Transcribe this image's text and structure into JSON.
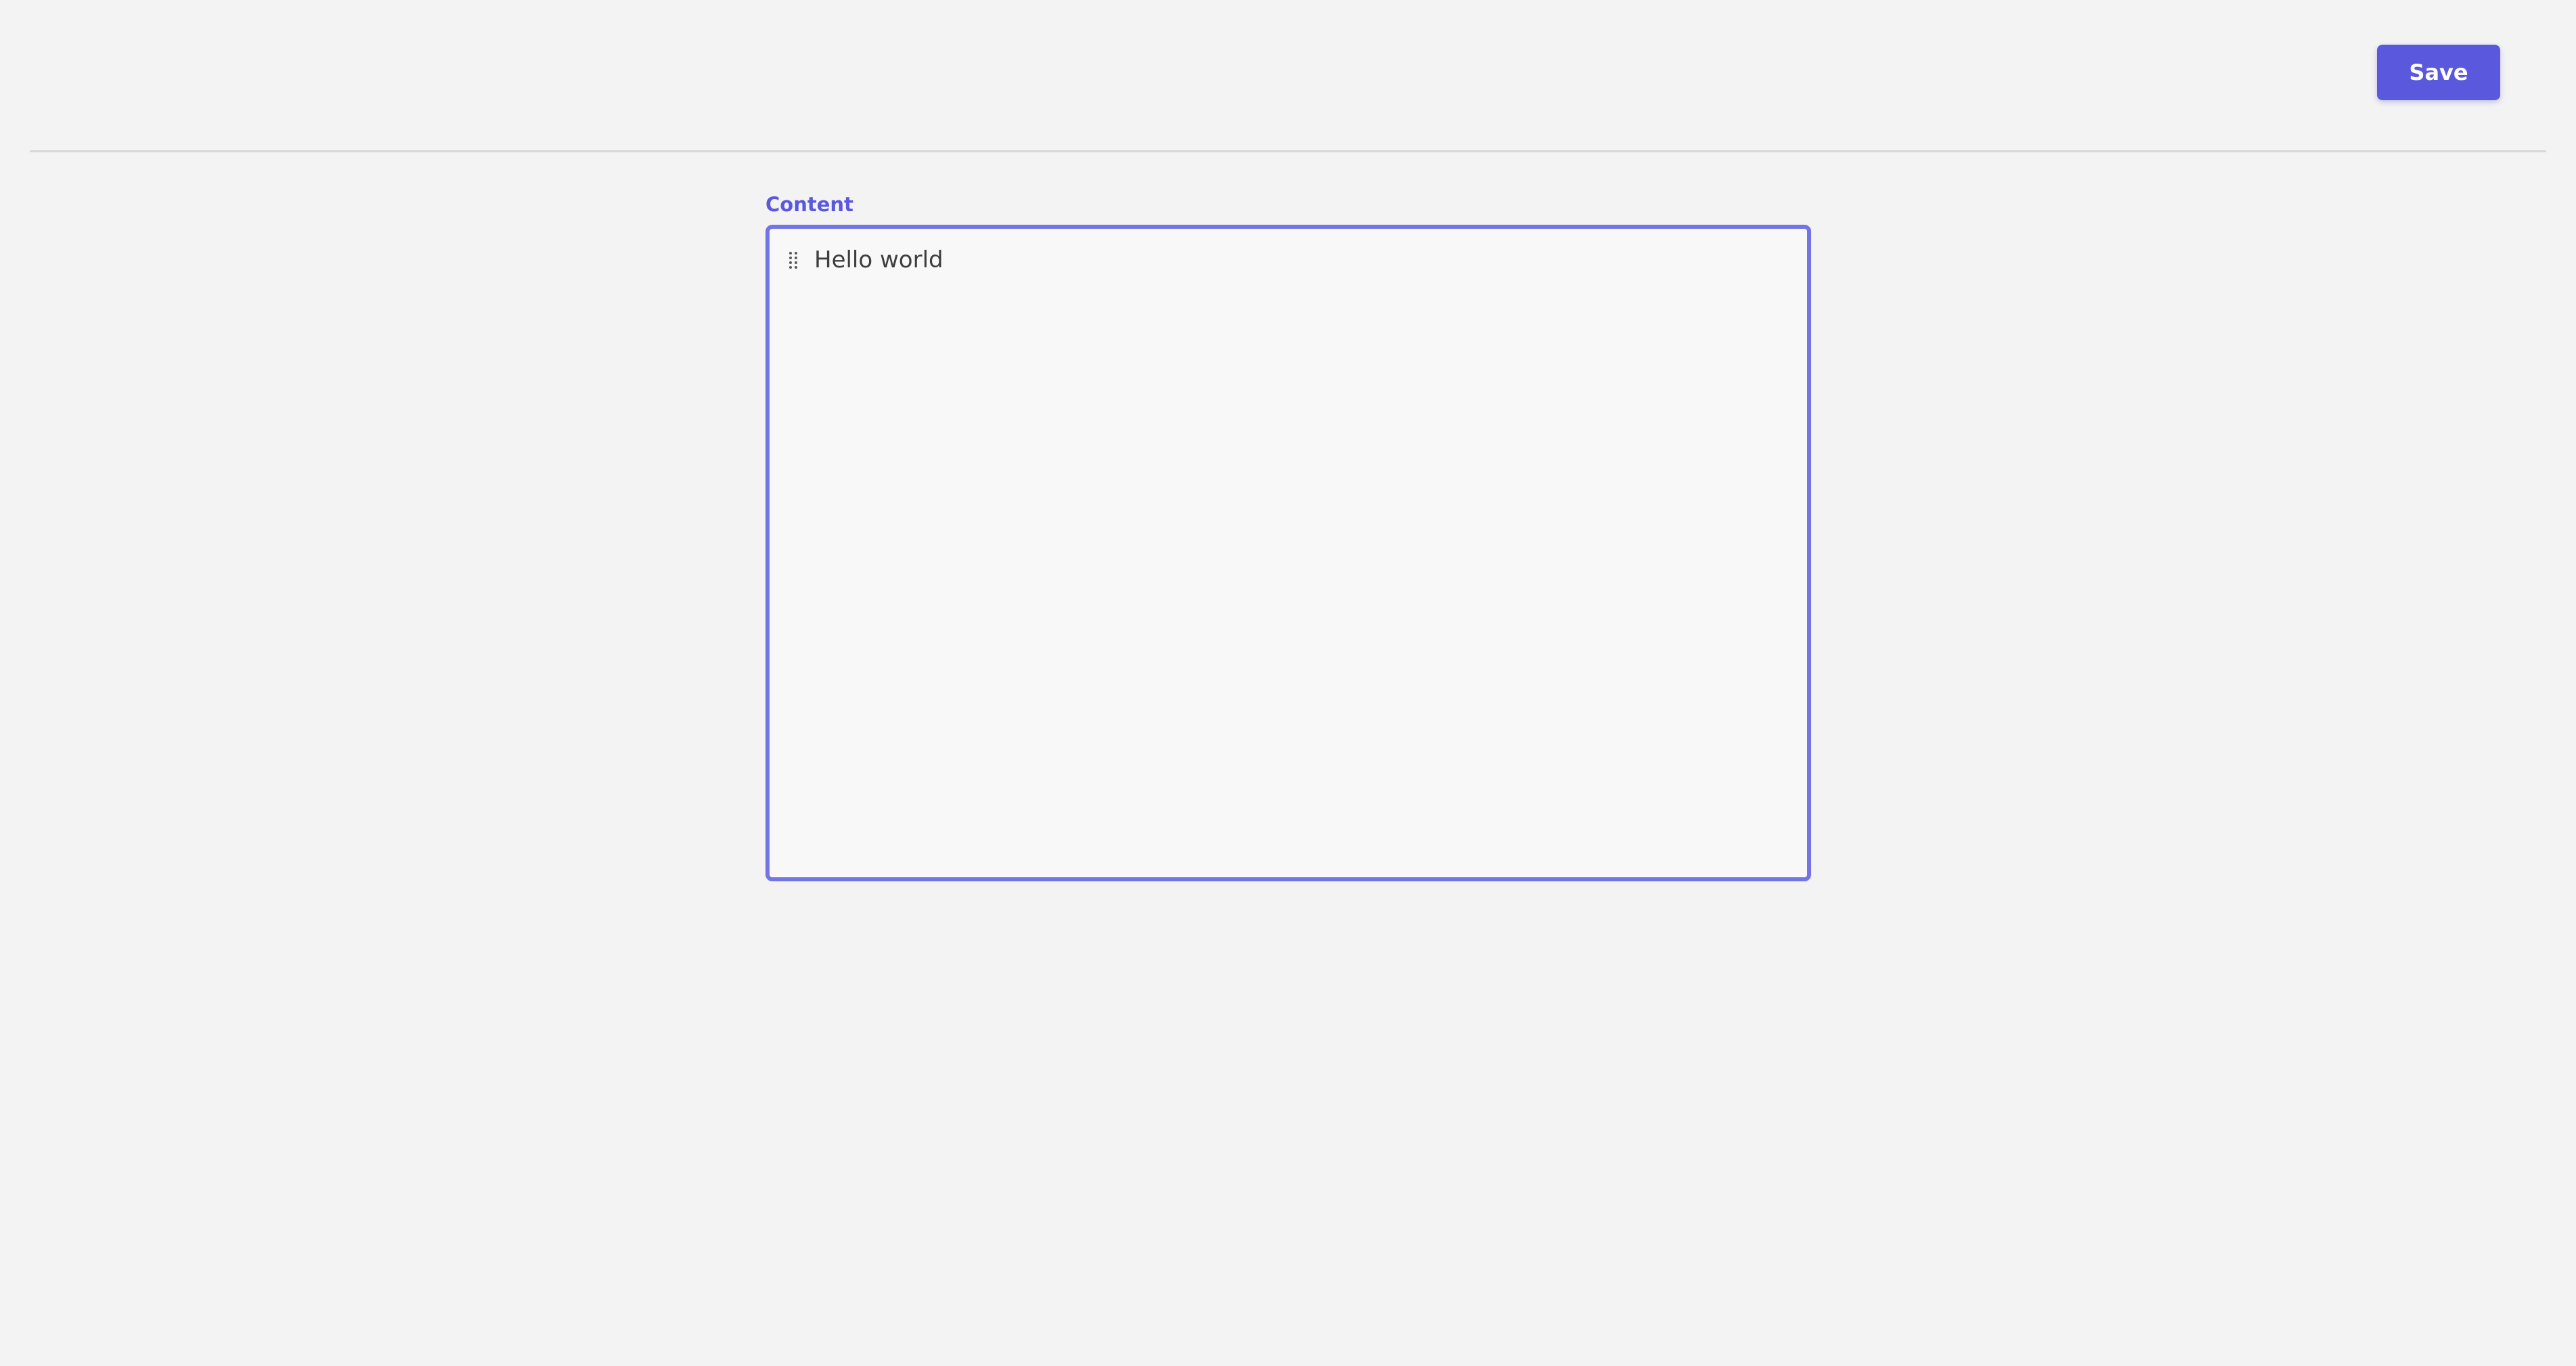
{
  "toolbar": {
    "save_label": "Save"
  },
  "field": {
    "label": "Content"
  },
  "editor": {
    "blocks": [
      {
        "text": "Hello world",
        "handle_icon": "drag-handle-icon"
      }
    ]
  },
  "colors": {
    "accent": "#5a58dc",
    "focus_border": "#7474e4",
    "background": "#f3f3f3",
    "editor_background": "#f8f8f8"
  }
}
